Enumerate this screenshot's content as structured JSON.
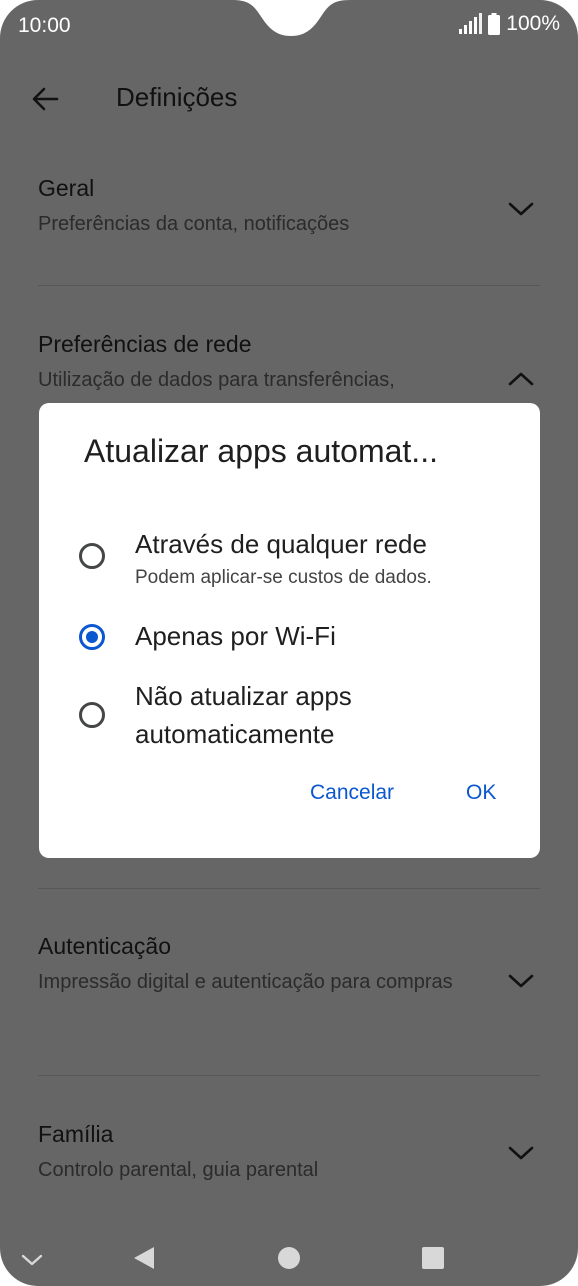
{
  "status_bar": {
    "time": "10:00",
    "battery": "100%",
    "signal_icon": "signal-icon",
    "battery_icon": "battery-icon"
  },
  "app_bar": {
    "title": "Definições",
    "back_icon": "arrow-back-icon"
  },
  "sections": [
    {
      "title": "Geral",
      "subtitle": "Preferências da conta, notificações",
      "expanded": false
    },
    {
      "title": "Preferências de rede",
      "subtitle": "Utilização de dados para transferências,",
      "expanded": true
    },
    {
      "title": "Autenticação",
      "subtitle": "Impressão digital e autenticação para compras",
      "expanded": false
    },
    {
      "title": "Família",
      "subtitle": "Controlo parental, guia parental",
      "expanded": false
    }
  ],
  "dialog": {
    "title": "Atualizar apps automat...",
    "options": [
      {
        "label": "Através de qualquer rede",
        "sublabel": "Podem aplicar-se custos de dados.",
        "selected": false
      },
      {
        "label": "Apenas por Wi-Fi",
        "selected": true
      },
      {
        "label": "Não atualizar apps automaticamente",
        "selected": false
      }
    ],
    "cancel_label": "Cancelar",
    "ok_label": "OK",
    "accent_color": "#0b57d0"
  },
  "nav_bar": {
    "items": [
      "chevron-down-icon",
      "back-triangle-icon",
      "home-circle-icon",
      "recents-square-icon"
    ]
  },
  "colors": {
    "scrim": "#666666",
    "dialog_bg": "#ffffff",
    "accent": "#0b57d0"
  }
}
